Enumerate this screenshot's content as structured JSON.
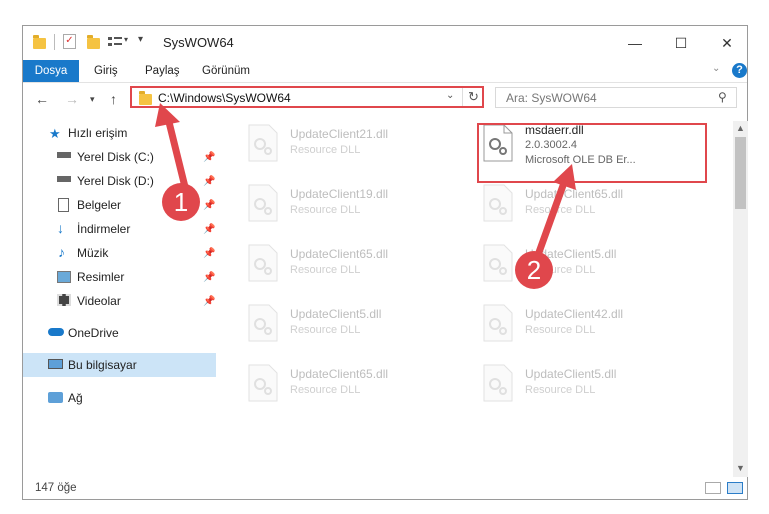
{
  "window": {
    "title": "SysWOW64",
    "minimize": "—",
    "maximize": "☐",
    "close": "✕"
  },
  "ribbon": {
    "tabs": [
      "Dosya",
      "Giriş",
      "Paylaş",
      "Görünüm"
    ]
  },
  "nav": {
    "address": "C:\\Windows\\SysWOW64",
    "search_placeholder": "Ara: SysWOW64"
  },
  "sidebar": {
    "items": [
      {
        "label": "Hızlı erişim",
        "icon": "star-icon",
        "pinned": false
      },
      {
        "label": "Yerel Disk (C:)",
        "icon": "drive-icon",
        "pinned": true
      },
      {
        "label": "Yerel Disk (D:)",
        "icon": "drive-icon",
        "pinned": true
      },
      {
        "label": "Belgeler",
        "icon": "documents-icon",
        "pinned": true
      },
      {
        "label": "İndirmeler",
        "icon": "download-icon",
        "pinned": true
      },
      {
        "label": "Müzik",
        "icon": "music-icon",
        "pinned": true
      },
      {
        "label": "Resimler",
        "icon": "pictures-icon",
        "pinned": true
      },
      {
        "label": "Videolar",
        "icon": "videos-icon",
        "pinned": true
      },
      {
        "label": "OneDrive",
        "icon": "cloud-icon",
        "pinned": false
      },
      {
        "label": "Bu bilgisayar",
        "icon": "computer-icon",
        "pinned": false
      },
      {
        "label": "Ağ",
        "icon": "network-icon",
        "pinned": false
      }
    ]
  },
  "files": [
    {
      "name": "UpdateClient21.dll",
      "type": "Resource DLL"
    },
    {
      "name": "msdaerr.dll",
      "version": "2.0.3002.4",
      "type": "Microsoft OLE DB Er..."
    },
    {
      "name": "UpdateClient19.dll",
      "type": "Resource DLL"
    },
    {
      "name": "UpdateClient65.dll",
      "type": "Resource DLL"
    },
    {
      "name": "UpdateClient65.dll",
      "type": "Resource DLL"
    },
    {
      "name": "UpdateClient5.dll",
      "type": "Resource DLL"
    },
    {
      "name": "UpdateClient5.dll",
      "type": "Resource DLL"
    },
    {
      "name": "UpdateClient42.dll",
      "type": "Resource DLL"
    },
    {
      "name": "UpdateClient65.dll",
      "type": "Resource DLL"
    },
    {
      "name": "UpdateClient5.dll",
      "type": "Resource DLL"
    }
  ],
  "status": {
    "count": "147 öğe"
  },
  "annotations": {
    "badge1": "1",
    "badge2": "2",
    "color": "#e0474c"
  }
}
